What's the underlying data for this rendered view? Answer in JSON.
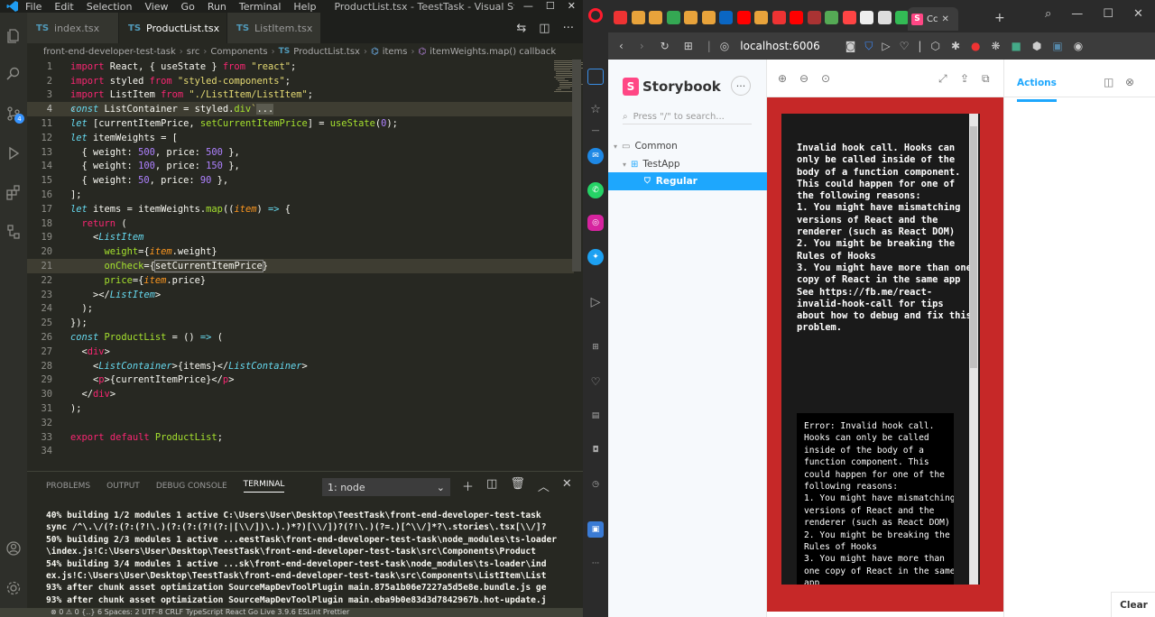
{
  "vscode": {
    "menu": [
      "File",
      "Edit",
      "Selection",
      "View",
      "Go",
      "Run",
      "Terminal",
      "Help"
    ],
    "window_title": "ProductList.tsx - TeestTask - Visual Studio ...",
    "tabs": [
      {
        "label": "index.tsx",
        "icon": "TS",
        "active": false
      },
      {
        "label": "ProductList.tsx",
        "icon": "TS",
        "active": true
      },
      {
        "label": "ListItem.tsx",
        "icon": "TS",
        "active": false
      }
    ],
    "breadcrumb": [
      "front-end-developer-test-task",
      "src",
      "Components",
      "ProductList.tsx",
      "items",
      "itemWeights.map() callback"
    ],
    "line_numbers": [
      "1",
      "2",
      "3",
      "4",
      "11",
      "12",
      "13",
      "14",
      "15",
      "16",
      "17",
      "18",
      "19",
      "20",
      "21",
      "22",
      "23",
      "24",
      "25",
      "26",
      "27",
      "28",
      "29",
      "30",
      "31",
      "32",
      "33",
      "34"
    ],
    "panel_tabs": [
      "PROBLEMS",
      "OUTPUT",
      "DEBUG CONSOLE",
      "TERMINAL"
    ],
    "terminal_select": "1: node",
    "terminal_lines": [
      "40% building 1/2 modules 1 active C:\\Users\\User\\Desktop\\TeestTask\\front-end-developer-test-task",
      "sync /^\\.\\/(?:(?:(?!\\.)(?:(?:(?!(?:|[\\\\/])\\.).)*?)[\\\\/])?(?!\\.)(?=.)[^\\\\/]*?\\.stories\\.tsx[\\\\/]?",
      "50% building 2/3 modules 1 active ...eestTask\\front-end-developer-test-task\\node_modules\\ts-loader",
      "\\index.js!C:\\Users\\User\\Desktop\\TeestTask\\front-end-developer-test-task\\src\\Components\\Product",
      "54% building 3/4 modules 1 active ...sk\\front-end-developer-test-task\\node_modules\\ts-loader\\ind",
      "ex.js!C:\\Users\\User\\Desktop\\TeestTask\\front-end-developer-test-task\\src\\Components\\ListItem\\List",
      "93% after chunk asset optimization SourceMapDevToolPlugin main.875a1b06e7227a5d5e8e.bundle.js ge",
      "93% after chunk asset optimization SourceMapDevToolPlugin main.eba9b0e83d3d7842967b.hot-update.j"
    ],
    "status": "⊗ 0 ⚠ 0   {..} 6        Spaces: 2   UTF-8   CRLF   TypeScript React   Go Live   3.9.6   ESLint   Prettier"
  },
  "browser": {
    "url": "localhost:6006",
    "tab_label": "Cc"
  },
  "storybook": {
    "brand": "Storybook",
    "search_placeholder": "Press \"/\" to search...",
    "tree": {
      "group": "Common",
      "component": "TestApp",
      "story": "Regular"
    },
    "addon_tab": "Actions",
    "clear_button": "Clear",
    "error_main": "Invalid hook call. Hooks can only be called inside of the body of a function component. This could happen for one of the following reasons:\n1. You might have mismatching versions of React and the renderer (such as React DOM)\n2. You might be breaking the Rules of Hooks\n3. You might have more than one copy of React in the same app\nSee https://fb.me/react-invalid-hook-call for tips about how to debug and fix this problem.",
    "error_stack": "Error: Invalid hook call. Hooks can only be called inside of the body of a function component. This could happen for one of the following reasons:\n1. You might have mismatching versions of React and the renderer (such as React DOM)\n2. You might be breaking the Rules of Hooks\n3. You might have more than one copy of React in the same app"
  },
  "colors": {
    "storybook_accent": "#ff4785",
    "error_red": "#c62828",
    "monokai_bg": "#272822",
    "selection_blue": "#1ea7fd"
  }
}
